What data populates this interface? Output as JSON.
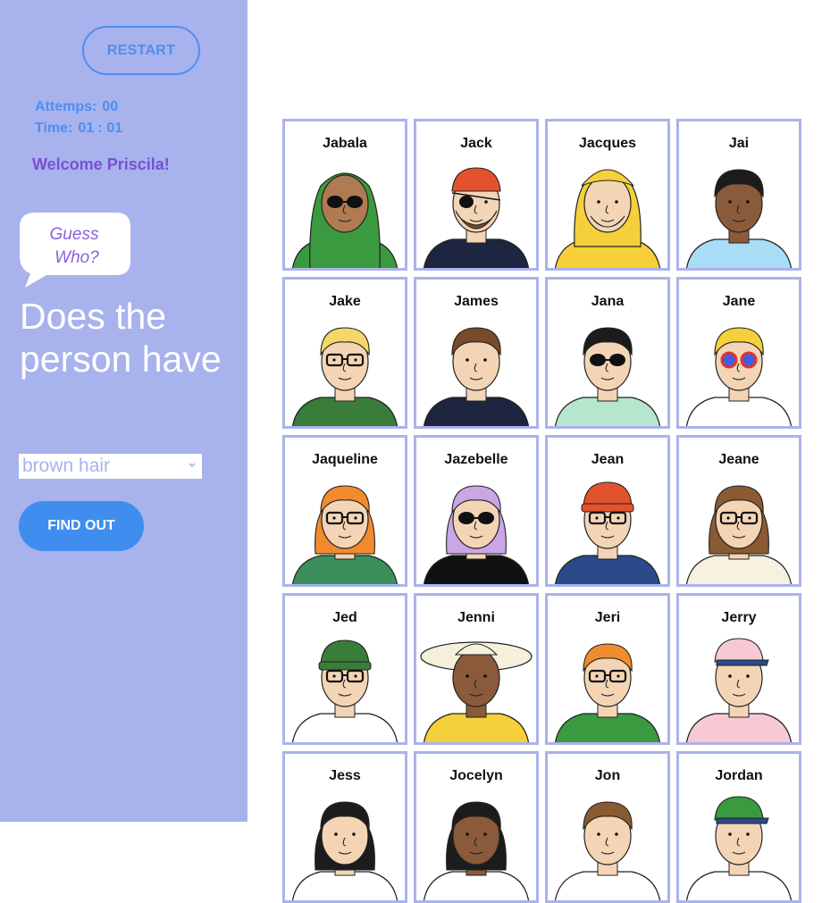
{
  "sidebar": {
    "restart_label": "RESTART",
    "attempts_label": "Attemps:",
    "attempts_value": "00",
    "time_label": "Time:",
    "time_value": "01 : 01",
    "welcome": "Welcome Priscila!",
    "bubble_line1": "Guess",
    "bubble_line2": "Who?",
    "question": "Does the person have",
    "selected_option": "brown hair",
    "find_label": "FIND OUT"
  },
  "colors": {
    "sidebar_bg": "#a8b2ec",
    "accent_blue": "#3f8def",
    "welcome_purple": "#7a4fd6",
    "card_border": "#aab3ec"
  },
  "characters": [
    {
      "name": "Jabala",
      "hair": "#3a9a3f",
      "skin": "#b07a52",
      "shirt": "#3a9a3f",
      "glasses": "sun",
      "hat": "hijab"
    },
    {
      "name": "Jack",
      "hair": "#e2532d",
      "skin": "#f3d5b5",
      "shirt": "#1e2540",
      "glasses": "patch",
      "hat": "bandana"
    },
    {
      "name": "Jacques",
      "hair": "#f5d03a",
      "skin": "#f3d5b5",
      "shirt": "#f5d03a",
      "glasses": "none",
      "hat": "raincoat"
    },
    {
      "name": "Jai",
      "hair": "#1c1c1c",
      "skin": "#8a5a3a",
      "shirt": "#a9dcf5",
      "glasses": "none",
      "hat": "none"
    },
    {
      "name": "Jake",
      "hair": "#f5d66a",
      "skin": "#f3d5b5",
      "shirt": "#3a7d3a",
      "glasses": "clear",
      "hat": "none"
    },
    {
      "name": "James",
      "hair": "#7a4a2a",
      "skin": "#f3d5b5",
      "shirt": "#1e2540",
      "glasses": "none",
      "hat": "none"
    },
    {
      "name": "Jana",
      "hair": "#1c1c1c",
      "skin": "#f3d5b5",
      "shirt": "#b7e6cf",
      "glasses": "sun",
      "hat": "none"
    },
    {
      "name": "Jane",
      "hair": "#f5d03a",
      "skin": "#f3d5b5",
      "shirt": "#ffffff",
      "glasses": "color",
      "hat": "none"
    },
    {
      "name": "Jaqueline",
      "hair": "#f28b2d",
      "skin": "#f3d5b5",
      "shirt": "#3a8f5a",
      "glasses": "clear",
      "hat": "none"
    },
    {
      "name": "Jazebelle",
      "hair": "#c9a6e6",
      "skin": "#f3d5b5",
      "shirt": "#111111",
      "glasses": "sun",
      "hat": "none"
    },
    {
      "name": "Jean",
      "hair": "#e2532d",
      "skin": "#f3d5b5",
      "shirt": "#2a4a8a",
      "glasses": "clear",
      "hat": "beanie"
    },
    {
      "name": "Jeane",
      "hair": "#8a5a32",
      "skin": "#f3d5b5",
      "shirt": "#f6f1e0",
      "glasses": "clear",
      "hat": "none"
    },
    {
      "name": "Jed",
      "hair": "#f28b2d",
      "skin": "#f3d5b5",
      "shirt": "#ffffff",
      "glasses": "clear",
      "hat": "beanie-green"
    },
    {
      "name": "Jenni",
      "hair": "#1c1c1c",
      "skin": "#8a5a3a",
      "shirt": "#f5d03a",
      "glasses": "none",
      "hat": "sunhat"
    },
    {
      "name": "Jeri",
      "hair": "#f28b2d",
      "skin": "#f3d5b5",
      "shirt": "#3a9a3f",
      "glasses": "round",
      "hat": "none"
    },
    {
      "name": "Jerry",
      "hair": "#1c1c1c",
      "skin": "#f3d5b5",
      "shirt": "#f6c9d3",
      "glasses": "none",
      "hat": "cap"
    },
    {
      "name": "Jess",
      "hair": "#1c1c1c",
      "skin": "#f3d5b5",
      "shirt": "#ffffff",
      "glasses": "none",
      "hat": "none"
    },
    {
      "name": "Jocelyn",
      "hair": "#1c1c1c",
      "skin": "#8a5a3a",
      "shirt": "#ffffff",
      "glasses": "none",
      "hat": "none"
    },
    {
      "name": "Jon",
      "hair": "#8a5a32",
      "skin": "#f3d5b5",
      "shirt": "#ffffff",
      "glasses": "none",
      "hat": "none"
    },
    {
      "name": "Jordan",
      "hair": "#f5d03a",
      "skin": "#f3d5b5",
      "shirt": "#ffffff",
      "glasses": "none",
      "hat": "cap-green"
    }
  ]
}
